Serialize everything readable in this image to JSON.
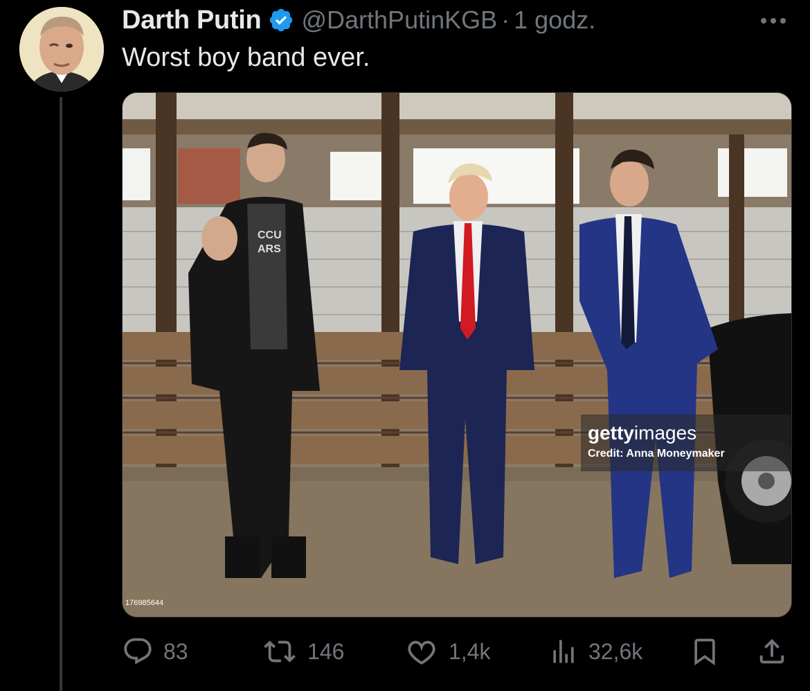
{
  "tweet": {
    "author": {
      "display_name": "Darth Putin",
      "handle": "@DarthPutinKGB",
      "verified": true
    },
    "separator": "·",
    "timestamp": "1 godz.",
    "text": "Worst boy band ever.",
    "media": {
      "watermark_brand_bold": "getty",
      "watermark_brand_light": "images",
      "watermark_credit": "Credit: Anna Moneymaker",
      "photo_id": "176985644"
    },
    "actions": {
      "replies": "83",
      "reposts": "146",
      "likes": "1,4k",
      "views": "32,6k"
    }
  },
  "icons": [
    "more-icon",
    "verified-badge-icon",
    "reply-icon",
    "repost-icon",
    "like-icon",
    "views-icon",
    "bookmark-icon",
    "share-icon"
  ],
  "colors": {
    "background": "#000000",
    "muted": "#71767b",
    "text": "#e7e9ea",
    "verified": "#1d9bf0"
  }
}
